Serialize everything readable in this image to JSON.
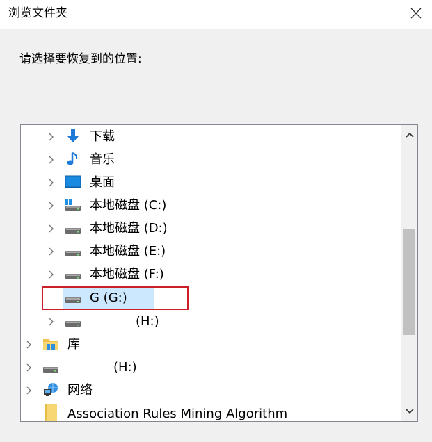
{
  "window": {
    "title": "浏览文件夹"
  },
  "prompt": "请选择要恢复到的位置:",
  "tree": [
    {
      "label": "下载",
      "icon": "download-arrow-icon"
    },
    {
      "label": "音乐",
      "icon": "music-note-icon"
    },
    {
      "label": "桌面",
      "icon": "desktop-icon"
    },
    {
      "label": "本地磁盘 (C:)",
      "icon": "windows-drive-icon"
    },
    {
      "label": "本地磁盘 (D:)",
      "icon": "drive-icon"
    },
    {
      "label": "本地磁盘 (E:)",
      "icon": "drive-icon"
    },
    {
      "label": "本地磁盘 (F:)",
      "icon": "drive-icon"
    },
    {
      "label": "G (G:)",
      "icon": "drive-icon",
      "selected": true
    },
    {
      "label": "(H:)",
      "icon": "drive-icon"
    },
    {
      "label": "库",
      "icon": "library-folder-icon"
    },
    {
      "label": "(H:)",
      "icon": "drive-icon"
    },
    {
      "label": "网络",
      "icon": "network-icon"
    },
    {
      "label": "Association Rules Mining Algorithm",
      "icon": "folder-icon"
    }
  ],
  "colors": {
    "selection": "#cce8ff",
    "highlight": "#cc1f2a",
    "accent": "#1e7ad6"
  }
}
